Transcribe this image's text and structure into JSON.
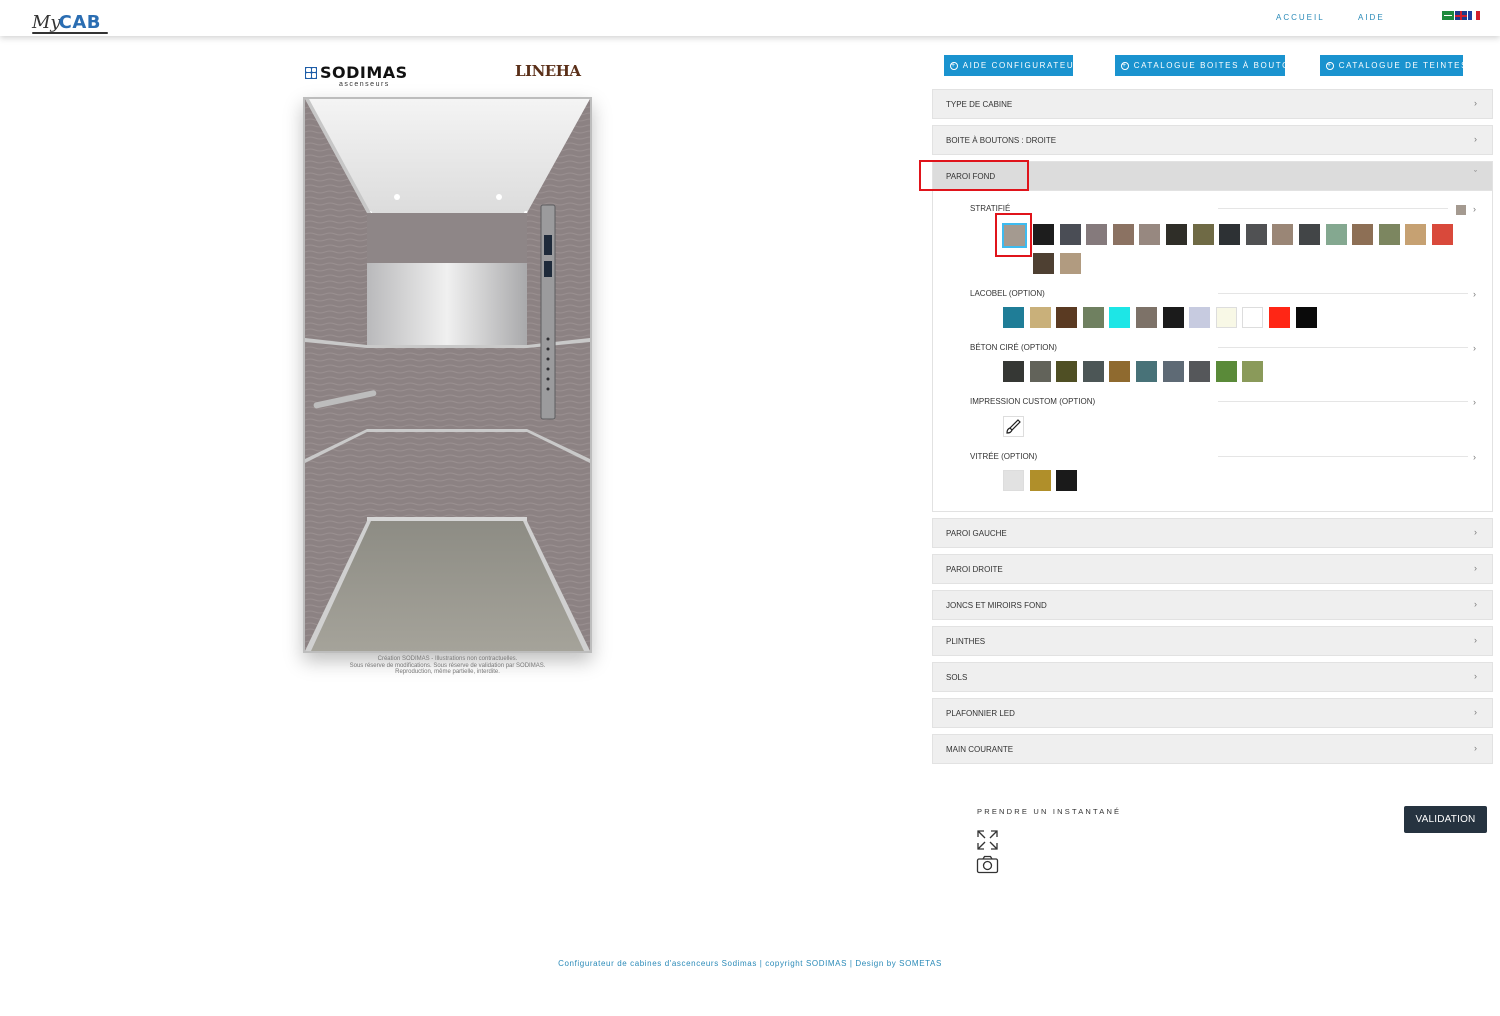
{
  "header": {
    "logo_my": "My",
    "logo_cab": "CAB",
    "nav_accueil": "ACCUEIL",
    "nav_aide": "AIDE",
    "languages": [
      "arabic-flag",
      "english-flag",
      "french-flag"
    ]
  },
  "preview": {
    "brand": "SODIMAS",
    "brand_sub": "ascenseurs",
    "collection": "LINEHA",
    "disclaimer_1": "Création SODIMAS - Illustrations non contractuelles.",
    "disclaimer_2": "Sous réserve de modifications. Sous réserve de validation par SODIMAS.",
    "disclaimer_3": "Reproduction, même partielle, interdite."
  },
  "buttons": {
    "aide": "AIDE CONFIGURATEUR",
    "catalogue_boites": "CATALOGUE BOITES À BOUTON",
    "catalogue_teintes": "CATALOGUE DE TEINTES."
  },
  "accordion": {
    "type_cabine": "TYPE DE CABINE",
    "boite": "BOITE À BOUTONS : DROITE",
    "paroi_fond": "PAROI FOND",
    "paroi_gauche": "PAROI GAUCHE",
    "paroi_droite": "PAROI DROITE",
    "joncs": "JONCS ET MIROIRS FOND",
    "plinthes": "PLINTHES",
    "sols": "SOLS",
    "plafonnier": "PLAFONNIER LED",
    "main_courante": "MAIN COURANTE"
  },
  "categories": {
    "stratifie": "STRATIFIÉ",
    "lacobel": "LACOBEL (OPTION)",
    "beton": "BÉTON CIRÉ (OPTION)",
    "impression": "IMPRESSION CUSTOM (OPTION)",
    "vitree": "VITRÉE (OPTION)"
  },
  "swatches": {
    "stratifie": [
      "#a49a90",
      "#1d1d1d",
      "#4a4d55",
      "#857a7c",
      "#8b7262",
      "#978880",
      "#2f2e28",
      "#6f6a45",
      "#2d3134",
      "#505153",
      "#9a8676",
      "#424547",
      "#84a890",
      "#8d6f55",
      "#7c8660",
      "#c6a172",
      "#d9493b",
      "#4e4032",
      "#b19b80"
    ],
    "lacobel": [
      "#1f7d97",
      "#c9b07a",
      "#5a3a22",
      "#6f8060",
      "#1de6e6",
      "#7d7268",
      "#1b1b1b",
      "#c7cbe0",
      "#f8f8e6",
      "#ffffff",
      "#ff2615",
      "#0a0a0a"
    ],
    "beton": [
      "#353734",
      "#62635a",
      "#4f4f24",
      "#4c5656",
      "#8f6a2f",
      "#487278",
      "#5e6a75",
      "#55575a",
      "#5a8a39",
      "#8a9a5a"
    ],
    "vitree": [
      "#e2e2e2",
      "#b08f2a",
      "#1a1a1a"
    ]
  },
  "selected_swatch_color": "#a49a90",
  "snapshot": {
    "label": "PRENDRE UN INSTANTANÉ"
  },
  "validation": "VALIDATION",
  "footer": {
    "text_1": "Configurateur de cabines d'ascenceurs Sodimas | copyright SODIMAS | Design by ",
    "text_2": "SOMETAS"
  }
}
